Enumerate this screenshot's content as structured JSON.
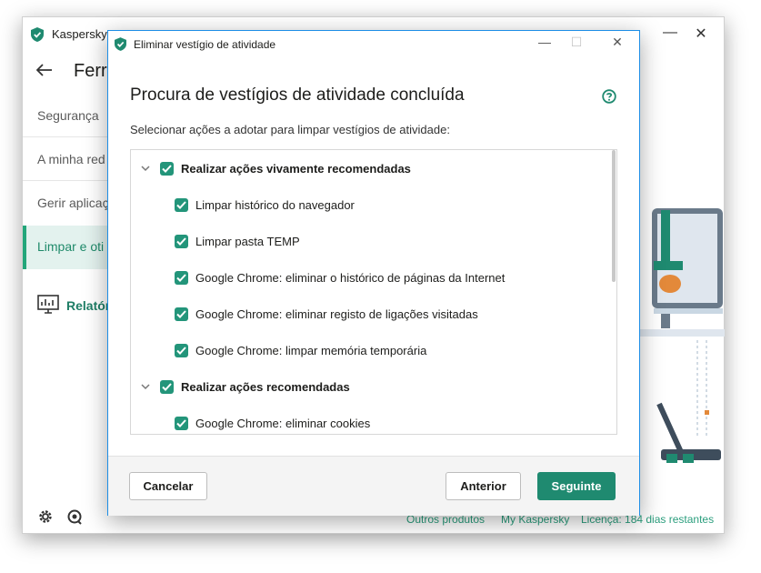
{
  "colors": {
    "accent": "#1f8a70",
    "checkbox": "#23957a",
    "link": "#2b9e7d",
    "dialog_border": "#1d8ee6"
  },
  "main_window": {
    "app_title": "Kaspersky",
    "section_title": "Ferra",
    "controls": {
      "minimize": "—",
      "close": "✕"
    },
    "nav": [
      {
        "label": "Segurança"
      },
      {
        "label": "A minha red"
      },
      {
        "label": "Gerir aplicaç"
      },
      {
        "label": "Limpar e oti"
      }
    ],
    "reports_label": "Relatór",
    "footer_links": [
      {
        "label": "Outros produtos"
      },
      {
        "label": "My Kaspersky"
      },
      {
        "label": "Licença: 184 dias restantes"
      }
    ]
  },
  "dialog": {
    "title": "Eliminar vestígio de atividade",
    "heading": "Procura de vestígios de atividade concluída",
    "subtitle": "Selecionar ações a adotar para limpar vestígios de atividade:",
    "controls": {
      "minimize": "—",
      "maximize": "☐",
      "close": "✕"
    },
    "groups": [
      {
        "label": "Realizar ações vivamente recomendadas",
        "checked": true,
        "expanded": true,
        "items": [
          {
            "label": "Limpar histórico do navegador",
            "checked": true
          },
          {
            "label": "Limpar pasta TEMP",
            "checked": true
          },
          {
            "label": "Google Chrome: eliminar o histórico de páginas da Internet",
            "checked": true
          },
          {
            "label": "Google Chrome: eliminar registo de ligações visitadas",
            "checked": true
          },
          {
            "label": "Google Chrome: limpar memória temporária",
            "checked": true
          }
        ]
      },
      {
        "label": "Realizar ações recomendadas",
        "checked": true,
        "expanded": true,
        "items": [
          {
            "label": "Google Chrome: eliminar cookies",
            "checked": true
          }
        ]
      }
    ],
    "buttons": {
      "cancel": "Cancelar",
      "previous": "Anterior",
      "next": "Seguinte"
    }
  }
}
